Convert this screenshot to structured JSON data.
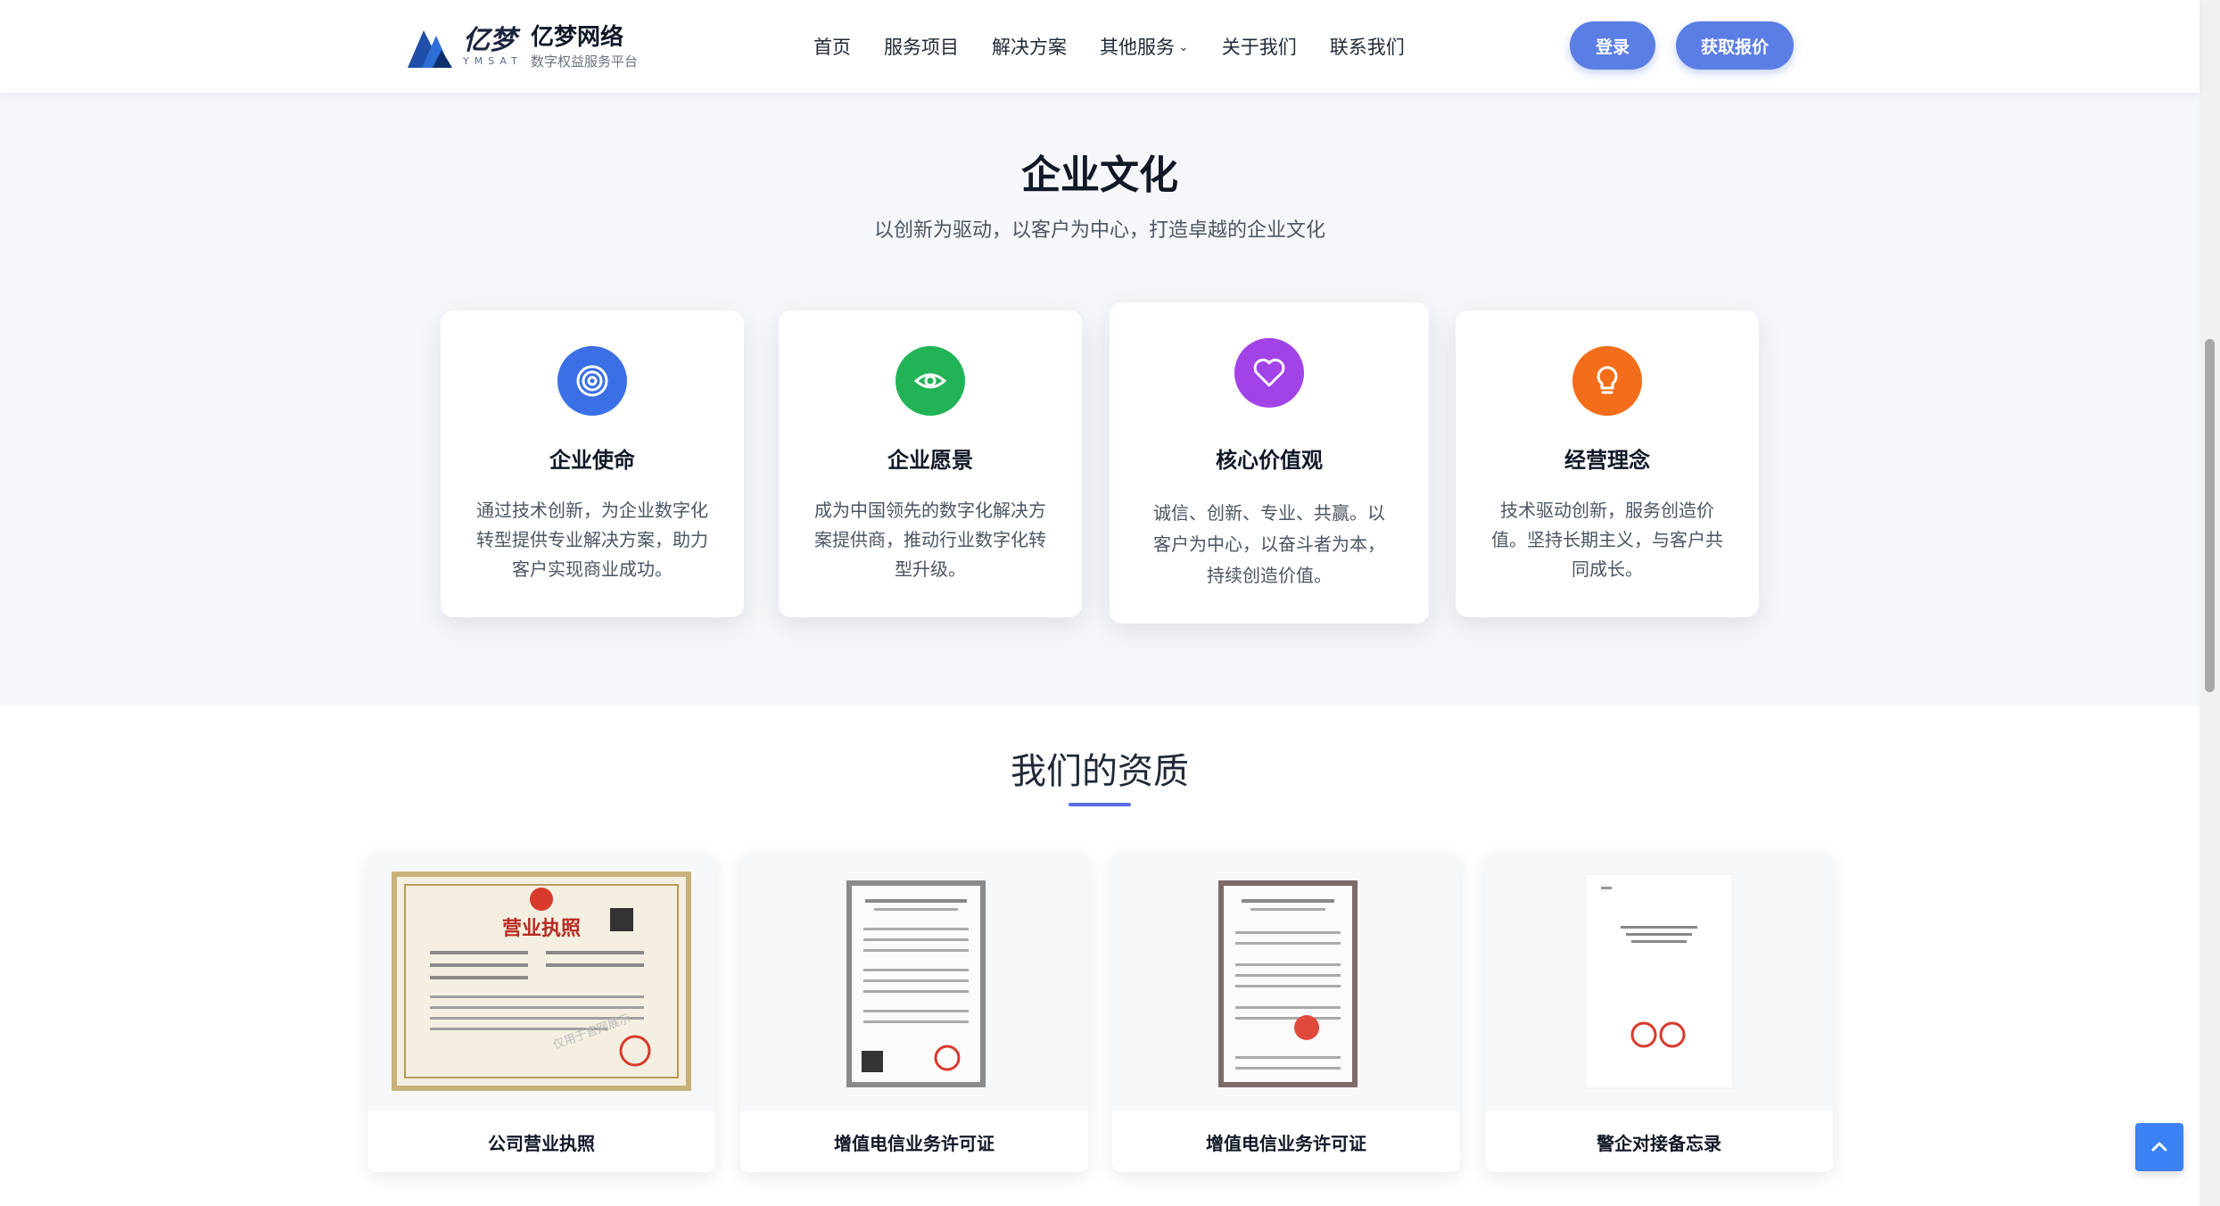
{
  "header": {
    "logo_text": "亿梦",
    "logo_en": "YMSAT",
    "brand_name": "亿梦网络",
    "brand_tagline": "数字权益服务平台",
    "nav": [
      "首页",
      "服务项目",
      "解决方案",
      "其他服务",
      "关于我们",
      "联系我们"
    ],
    "login_label": "登录",
    "quote_label": "获取报价"
  },
  "culture": {
    "title": "企业文化",
    "subtitle": "以创新为驱动，以客户为中心，打造卓越的企业文化",
    "cards": [
      {
        "icon": "target-icon",
        "color": "#3b6fe6",
        "title": "企业使命",
        "text": "通过技术创新，为企业数字化转型提供专业解决方案，助力客户实现商业成功。"
      },
      {
        "icon": "eye-icon",
        "color": "#22b357",
        "title": "企业愿景",
        "text": "成为中国领先的数字化解决方案提供商，推动行业数字化转型升级。"
      },
      {
        "icon": "heart-icon",
        "color": "#a243e8",
        "title": "核心价值观",
        "text": "诚信、创新、专业、共赢。以客户为中心，以奋斗者为本，持续创造价值。"
      },
      {
        "icon": "lightbulb-icon",
        "color": "#f46d1b",
        "title": "经营理念",
        "text": "技术驱动创新，服务创造价值。坚持长期主义，与客户共同成长。"
      }
    ]
  },
  "qualifications": {
    "title": "我们的资质",
    "items": [
      {
        "caption": "公司营业执照",
        "stamp": "营业执照",
        "watermark": "仅用于官网展示"
      },
      {
        "caption": "增值电信业务许可证"
      },
      {
        "caption": "增值电信业务许可证"
      },
      {
        "caption": "警企对接备忘录"
      }
    ]
  },
  "colors": {
    "accent": "#5b7ee5",
    "section_bg": "#f6f7fa",
    "back_to_top": "#3b82f6"
  }
}
